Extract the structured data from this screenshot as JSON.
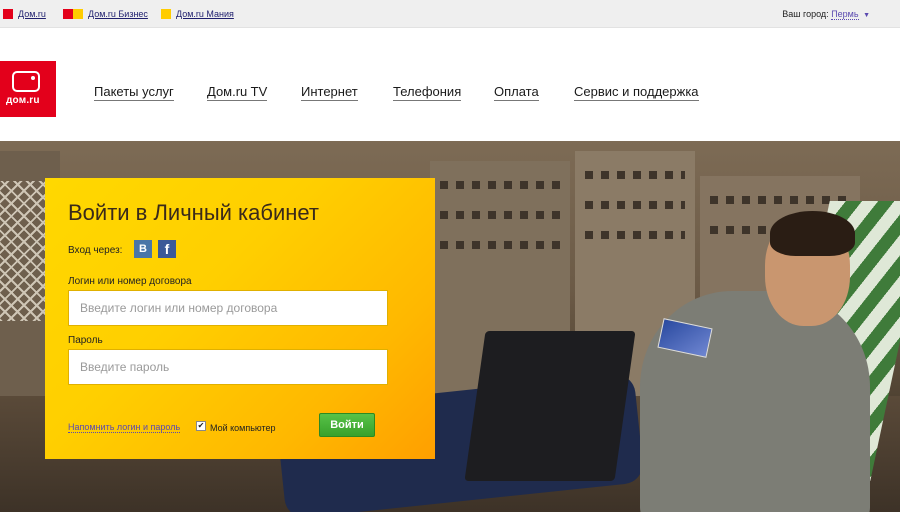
{
  "topbar": {
    "links": [
      {
        "label": "Дом.ru"
      },
      {
        "label": "Дом.ru Бизнес"
      },
      {
        "label": "Дом.ru Мания"
      }
    ],
    "city_label": "Ваш город:",
    "city_name": "Пермь"
  },
  "header": {
    "logo_text": "дом.ru",
    "nav": [
      {
        "label": "Пакеты услуг"
      },
      {
        "label": "Дом.ru TV"
      },
      {
        "label": "Интернет"
      },
      {
        "label": "Телефония"
      },
      {
        "label": "Оплата"
      },
      {
        "label": "Сервис и поддержка"
      }
    ]
  },
  "login": {
    "title": "Войти в Личный кабинет",
    "social_label": "Вход через:",
    "social_vk": "В",
    "social_fb": "f",
    "login_label": "Логин или номер договора",
    "login_placeholder": "Введите логин или номер договора",
    "password_label": "Пароль",
    "password_placeholder": "Введите пароль",
    "remind_link": "Напомнить логин и пароль",
    "remember_label": "Мой компьютер",
    "remember_checked": true,
    "submit_label": "Войти"
  },
  "colors": {
    "brand_red": "#e3001b",
    "brand_yellow": "#ffcc00",
    "button_green": "#43ad35",
    "link_purple": "#5b4ab0"
  },
  "icons": {
    "vk": "vk-icon",
    "fb": "facebook-icon",
    "logo": "tv-logo-icon",
    "caret": "caret-down-icon"
  }
}
